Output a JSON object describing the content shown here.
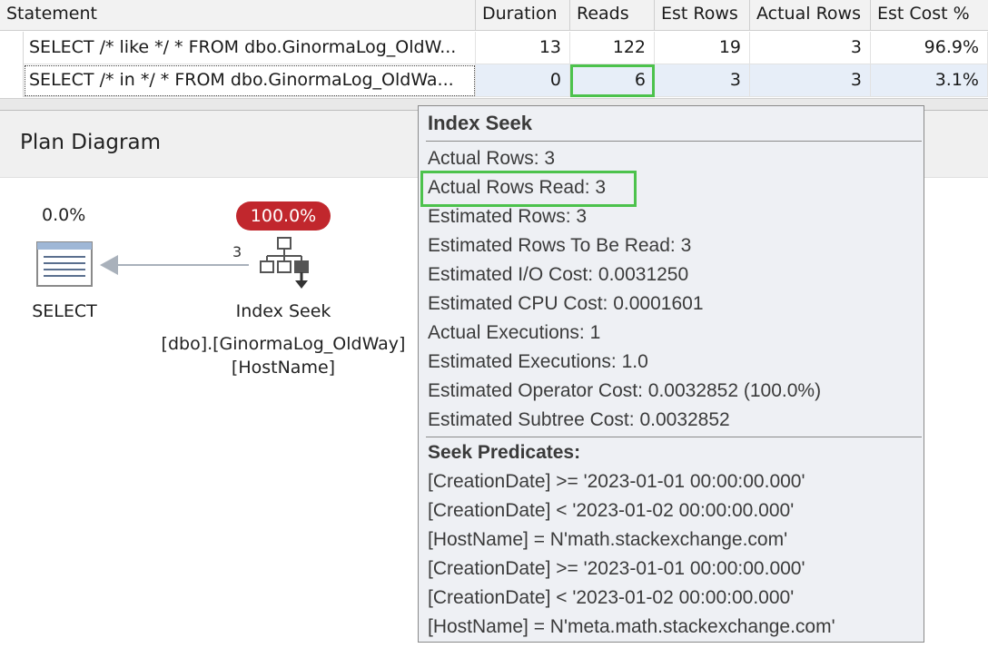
{
  "grid": {
    "columns": [
      "Statement",
      "Duration",
      "Reads",
      "Est Rows",
      "Actual Rows",
      "Est Cost %"
    ],
    "rows": [
      {
        "statement": "SELECT /* like */ * FROM dbo.GinormaLog_OldW...",
        "duration": "13",
        "reads": "122",
        "est_rows": "19",
        "actual_rows": "3",
        "est_cost": "96.9%"
      },
      {
        "statement": "SELECT /* in */ * FROM dbo.GinormaLog_OldWa...",
        "duration": "0",
        "reads": "6",
        "est_rows": "3",
        "actual_rows": "3",
        "est_cost": "3.1%"
      }
    ]
  },
  "plan": {
    "title": "Plan Diagram",
    "select_node": {
      "cost": "0.0%",
      "label": "SELECT"
    },
    "seek_node": {
      "cost": "100.0%",
      "label": "Index Seek",
      "object": "[dbo].[GinormaLog_OldWay]",
      "index": "[HostName]"
    },
    "edge_rows": "3"
  },
  "tooltip": {
    "title": "Index Seek",
    "lines": [
      "Actual Rows:  3",
      "Actual Rows Read:  3",
      "Estimated Rows:  3",
      "Estimated Rows To Be Read:  3",
      "Estimated I/O Cost:  0.0031250",
      "Estimated CPU Cost:  0.0001601",
      "Actual Executions:  1",
      "Estimated Executions:  1.0",
      "Estimated Operator Cost:  0.0032852 (100.0%)",
      "Estimated Subtree Cost:  0.0032852"
    ],
    "predicates_title": "Seek Predicates:",
    "predicates": [
      "[CreationDate] >= '2023-01-01 00:00:00.000'",
      "[CreationDate] < '2023-01-02 00:00:00.000'",
      "[HostName] = N'math.stackexchange.com'",
      "[CreationDate] >= '2023-01-01 00:00:00.000'",
      "[CreationDate] < '2023-01-02 00:00:00.000'",
      "[HostName] = N'meta.math.stackexchange.com'"
    ]
  },
  "colors": {
    "highlight": "#4cc24c",
    "badge": "#c1272d",
    "selected_row": "#e7eef8"
  }
}
